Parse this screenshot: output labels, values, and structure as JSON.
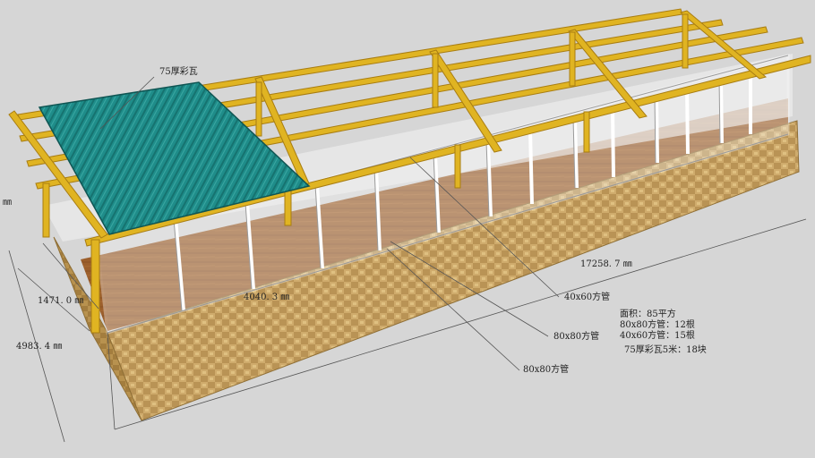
{
  "labels": {
    "roof_label": "75厚彩瓦",
    "dim_length": "17258. 7 ㎜",
    "dim_segment": "4040. 3 ㎜",
    "dim_wall": "1471. 0 ㎜",
    "dim_depth": "4983. 4 ㎜",
    "dim_left_edge": "㎜",
    "tube_40x60": "40x60方管",
    "tube_80x80_a": "80x80方管",
    "tube_80x80_b": "80x80方管"
  },
  "notes": {
    "area": "面积：85平方",
    "tube_80_count": "80x80方管：12根",
    "tube_40_count": "40x60方管：15根",
    "roof_count": "75厚彩瓦5米：18块"
  },
  "colors": {
    "background": "#d9d9d9",
    "beam": "#e0b422",
    "beam_dark": "#a87d12",
    "roof": "#1e8a87",
    "floor": "#9c5f2c",
    "wall": "#c9a56b",
    "frame": "#f2f2f2"
  }
}
